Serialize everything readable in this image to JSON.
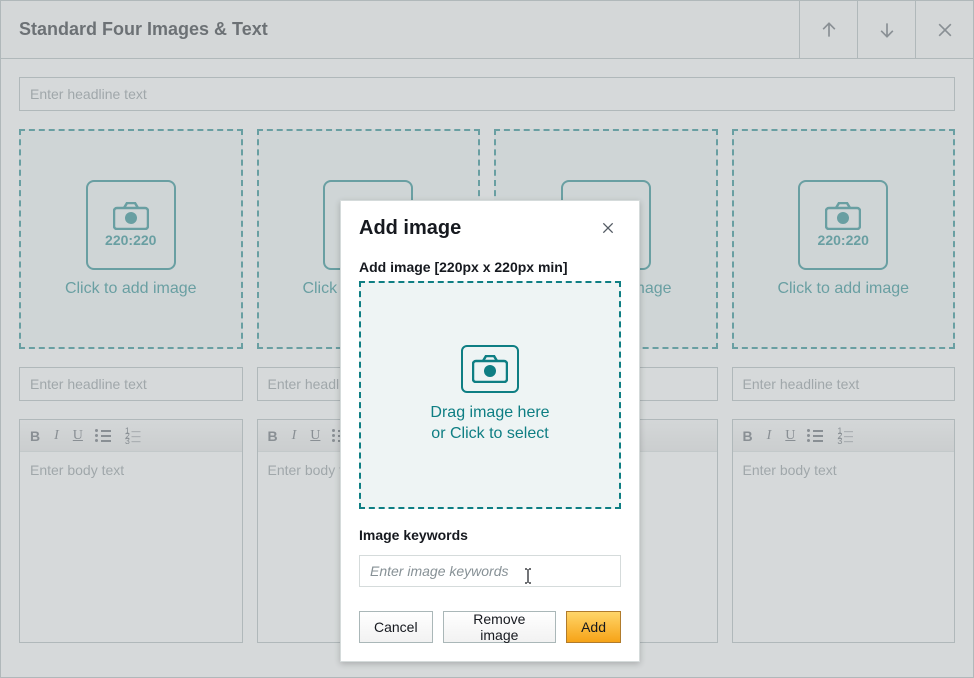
{
  "header": {
    "title": "Standard Four Images & Text"
  },
  "main": {
    "headline_placeholder": "Enter headline text",
    "image_slot": {
      "dim_label": "220:220",
      "click_label": "Click to add image"
    },
    "sub_headline_placeholder": "Enter headline text",
    "body_placeholder": "Enter body text",
    "toolbar": {
      "bold": "B",
      "italic": "I",
      "underline": "U"
    }
  },
  "modal": {
    "title": "Add image",
    "add_image_label": "Add image [220px x 220px min]",
    "drop_line1": "Drag image here",
    "drop_line2": "or Click to select",
    "keywords_label": "Image keywords",
    "keywords_placeholder": "Enter image keywords",
    "cancel": "Cancel",
    "remove": "Remove image",
    "add": "Add"
  }
}
